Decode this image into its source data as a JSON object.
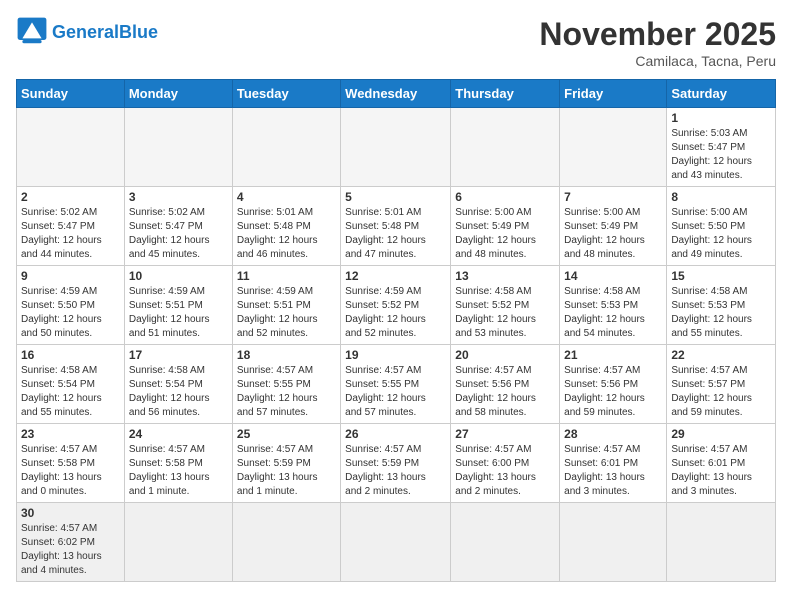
{
  "header": {
    "logo_general": "General",
    "logo_blue": "Blue",
    "title": "November 2025",
    "subtitle": "Camilaca, Tacna, Peru"
  },
  "weekdays": [
    "Sunday",
    "Monday",
    "Tuesday",
    "Wednesday",
    "Thursday",
    "Friday",
    "Saturday"
  ],
  "weeks": [
    [
      {
        "day": "",
        "info": ""
      },
      {
        "day": "",
        "info": ""
      },
      {
        "day": "",
        "info": ""
      },
      {
        "day": "",
        "info": ""
      },
      {
        "day": "",
        "info": ""
      },
      {
        "day": "",
        "info": ""
      },
      {
        "day": "1",
        "info": "Sunrise: 5:03 AM\nSunset: 5:47 PM\nDaylight: 12 hours\nand 43 minutes."
      }
    ],
    [
      {
        "day": "2",
        "info": "Sunrise: 5:02 AM\nSunset: 5:47 PM\nDaylight: 12 hours\nand 44 minutes."
      },
      {
        "day": "3",
        "info": "Sunrise: 5:02 AM\nSunset: 5:47 PM\nDaylight: 12 hours\nand 45 minutes."
      },
      {
        "day": "4",
        "info": "Sunrise: 5:01 AM\nSunset: 5:48 PM\nDaylight: 12 hours\nand 46 minutes."
      },
      {
        "day": "5",
        "info": "Sunrise: 5:01 AM\nSunset: 5:48 PM\nDaylight: 12 hours\nand 47 minutes."
      },
      {
        "day": "6",
        "info": "Sunrise: 5:00 AM\nSunset: 5:49 PM\nDaylight: 12 hours\nand 48 minutes."
      },
      {
        "day": "7",
        "info": "Sunrise: 5:00 AM\nSunset: 5:49 PM\nDaylight: 12 hours\nand 48 minutes."
      },
      {
        "day": "8",
        "info": "Sunrise: 5:00 AM\nSunset: 5:50 PM\nDaylight: 12 hours\nand 49 minutes."
      }
    ],
    [
      {
        "day": "9",
        "info": "Sunrise: 4:59 AM\nSunset: 5:50 PM\nDaylight: 12 hours\nand 50 minutes."
      },
      {
        "day": "10",
        "info": "Sunrise: 4:59 AM\nSunset: 5:51 PM\nDaylight: 12 hours\nand 51 minutes."
      },
      {
        "day": "11",
        "info": "Sunrise: 4:59 AM\nSunset: 5:51 PM\nDaylight: 12 hours\nand 52 minutes."
      },
      {
        "day": "12",
        "info": "Sunrise: 4:59 AM\nSunset: 5:52 PM\nDaylight: 12 hours\nand 52 minutes."
      },
      {
        "day": "13",
        "info": "Sunrise: 4:58 AM\nSunset: 5:52 PM\nDaylight: 12 hours\nand 53 minutes."
      },
      {
        "day": "14",
        "info": "Sunrise: 4:58 AM\nSunset: 5:53 PM\nDaylight: 12 hours\nand 54 minutes."
      },
      {
        "day": "15",
        "info": "Sunrise: 4:58 AM\nSunset: 5:53 PM\nDaylight: 12 hours\nand 55 minutes."
      }
    ],
    [
      {
        "day": "16",
        "info": "Sunrise: 4:58 AM\nSunset: 5:54 PM\nDaylight: 12 hours\nand 55 minutes."
      },
      {
        "day": "17",
        "info": "Sunrise: 4:58 AM\nSunset: 5:54 PM\nDaylight: 12 hours\nand 56 minutes."
      },
      {
        "day": "18",
        "info": "Sunrise: 4:57 AM\nSunset: 5:55 PM\nDaylight: 12 hours\nand 57 minutes."
      },
      {
        "day": "19",
        "info": "Sunrise: 4:57 AM\nSunset: 5:55 PM\nDaylight: 12 hours\nand 57 minutes."
      },
      {
        "day": "20",
        "info": "Sunrise: 4:57 AM\nSunset: 5:56 PM\nDaylight: 12 hours\nand 58 minutes."
      },
      {
        "day": "21",
        "info": "Sunrise: 4:57 AM\nSunset: 5:56 PM\nDaylight: 12 hours\nand 59 minutes."
      },
      {
        "day": "22",
        "info": "Sunrise: 4:57 AM\nSunset: 5:57 PM\nDaylight: 12 hours\nand 59 minutes."
      }
    ],
    [
      {
        "day": "23",
        "info": "Sunrise: 4:57 AM\nSunset: 5:58 PM\nDaylight: 13 hours\nand 0 minutes."
      },
      {
        "day": "24",
        "info": "Sunrise: 4:57 AM\nSunset: 5:58 PM\nDaylight: 13 hours\nand 1 minute."
      },
      {
        "day": "25",
        "info": "Sunrise: 4:57 AM\nSunset: 5:59 PM\nDaylight: 13 hours\nand 1 minute."
      },
      {
        "day": "26",
        "info": "Sunrise: 4:57 AM\nSunset: 5:59 PM\nDaylight: 13 hours\nand 2 minutes."
      },
      {
        "day": "27",
        "info": "Sunrise: 4:57 AM\nSunset: 6:00 PM\nDaylight: 13 hours\nand 2 minutes."
      },
      {
        "day": "28",
        "info": "Sunrise: 4:57 AM\nSunset: 6:01 PM\nDaylight: 13 hours\nand 3 minutes."
      },
      {
        "day": "29",
        "info": "Sunrise: 4:57 AM\nSunset: 6:01 PM\nDaylight: 13 hours\nand 3 minutes."
      }
    ],
    [
      {
        "day": "30",
        "info": "Sunrise: 4:57 AM\nSunset: 6:02 PM\nDaylight: 13 hours\nand 4 minutes."
      },
      {
        "day": "",
        "info": ""
      },
      {
        "day": "",
        "info": ""
      },
      {
        "day": "",
        "info": ""
      },
      {
        "day": "",
        "info": ""
      },
      {
        "day": "",
        "info": ""
      },
      {
        "day": "",
        "info": ""
      }
    ]
  ]
}
